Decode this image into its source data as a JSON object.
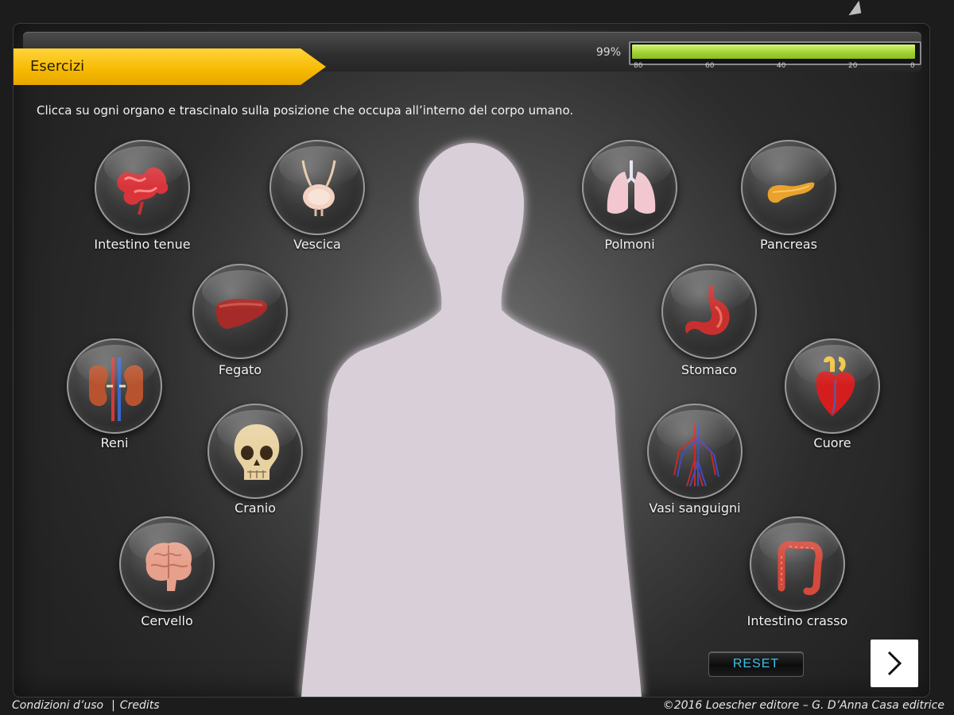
{
  "header": {
    "section_title": "Esercizi",
    "progress_text": "99%",
    "progress_value": 0.99,
    "scale_ticks": [
      "80",
      "60",
      "40",
      "20",
      "0"
    ]
  },
  "instruction": "Clicca su ogni organo e trascinalo sulla posizione che occupa all’interno del corpo umano.",
  "organs": [
    {
      "label": "Intestino tenue",
      "icon": "small-intestine-icon"
    },
    {
      "label": "Vescica",
      "icon": "bladder-icon"
    },
    {
      "label": "Polmoni",
      "icon": "lungs-icon"
    },
    {
      "label": "Pancreas",
      "icon": "pancreas-icon"
    },
    {
      "label": "Fegato",
      "icon": "liver-icon"
    },
    {
      "label": "Stomaco",
      "icon": "stomach-icon"
    },
    {
      "label": "Reni",
      "icon": "kidneys-icon"
    },
    {
      "label": "Cuore",
      "icon": "heart-icon"
    },
    {
      "label": "Cranio",
      "icon": "skull-icon"
    },
    {
      "label": "Vasi sanguigni",
      "icon": "blood-vessels-icon"
    },
    {
      "label": "Cervello",
      "icon": "brain-icon"
    },
    {
      "label": "Intestino crasso",
      "icon": "large-intestine-icon"
    }
  ],
  "controls": {
    "reset_label": "RESET",
    "next_icon": "chevron-right-icon"
  },
  "footer": {
    "terms": "Condizioni d’uso",
    "separator": "|",
    "credits": "Credits",
    "copyright": "©2016 Loescher editore – G. D’Anna Casa editrice"
  },
  "colors": {
    "banner": "#f6b900",
    "progress_fill": "#a3d234",
    "silhouette": "#d9cfd9",
    "reset_text": "#3fc0e8"
  }
}
